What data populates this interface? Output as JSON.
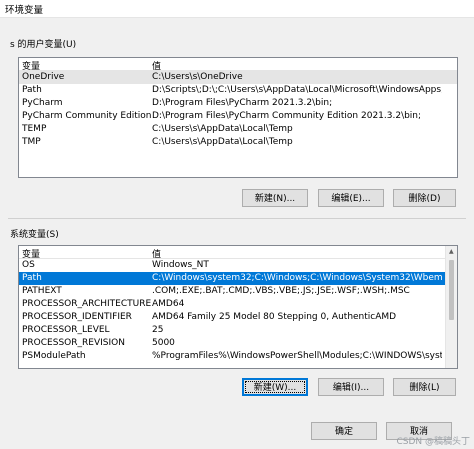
{
  "window": {
    "title": "环境变量"
  },
  "user_section": {
    "label": "s 的用户变量(U)",
    "columns": [
      "变量",
      "值"
    ],
    "rows": [
      {
        "name": "OneDrive",
        "value": "C:\\Users\\s\\OneDrive"
      },
      {
        "name": "Path",
        "value": "D:\\Scripts\\;D:\\;C:\\Users\\s\\AppData\\Local\\Microsoft\\WindowsApps;..."
      },
      {
        "name": "PyCharm",
        "value": "D:\\Program Files\\PyCharm 2021.3.2\\bin;"
      },
      {
        "name": "PyCharm Community Edition",
        "value": "D:\\Program Files\\PyCharm Community Edition 2021.3.2\\bin;"
      },
      {
        "name": "TEMP",
        "value": "C:\\Users\\s\\AppData\\Local\\Temp"
      },
      {
        "name": "TMP",
        "value": "C:\\Users\\s\\AppData\\Local\\Temp"
      }
    ],
    "buttons": {
      "new": "新建(N)...",
      "edit": "编辑(E)...",
      "delete": "删除(D)"
    }
  },
  "system_section": {
    "label": "系统变量(S)",
    "columns": [
      "变量",
      "值"
    ],
    "rows": [
      {
        "name": "OS",
        "value": "Windows_NT"
      },
      {
        "name": "Path",
        "value": "C:\\Windows\\system32;C:\\Windows;C:\\Windows\\System32\\Wbem;..."
      },
      {
        "name": "PATHEXT",
        "value": ".COM;.EXE;.BAT;.CMD;.VBS;.VBE;.JS;.JSE;.WSF;.WSH;.MSC"
      },
      {
        "name": "PROCESSOR_ARCHITECTURE",
        "value": "AMD64"
      },
      {
        "name": "PROCESSOR_IDENTIFIER",
        "value": "AMD64 Family 25 Model 80 Stepping 0, AuthenticAMD"
      },
      {
        "name": "PROCESSOR_LEVEL",
        "value": "25"
      },
      {
        "name": "PROCESSOR_REVISION",
        "value": "5000"
      },
      {
        "name": "PSModulePath",
        "value": "%ProgramFiles%\\WindowsPowerShell\\Modules;C:\\WINDOWS\\syst..."
      }
    ],
    "buttons": {
      "new": "新建(W)...",
      "edit": "编辑(I)...",
      "delete": "删除(L)"
    }
  },
  "footer": {
    "ok": "确定",
    "cancel": "取消"
  },
  "watermark": "CSDN @稿稿头丁",
  "colors": {
    "selection_blue": "#0078d7",
    "selection_grey": "#e5e5e5"
  }
}
